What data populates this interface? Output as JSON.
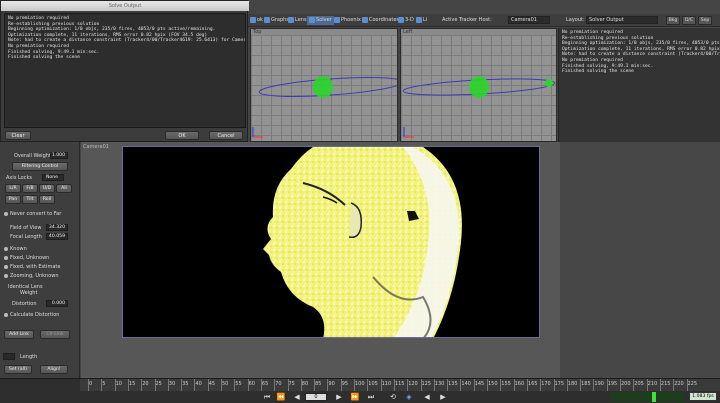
{
  "dialog": {
    "title": "Solve Output",
    "log": [
      "No premiation required",
      "Re-establishing previous solution",
      "Beginning optimization: 1/0 objs, 235/0 fires, 4053/0 pts active/remaining.",
      "Optimization complete, 11 iterations, RMS error 0.82 hpix (FOV 34.5 deg)",
      "Note: had to create a distance constraint (Tracker4/00/Tracker4619: 25.6413) for Camera01)",
      "No premiation required",
      "Finished solving, 9:49.1 min:sec.",
      "Finished solving the scene"
    ],
    "buttons": {
      "clear": "Clear",
      "ok": "OK",
      "cancel": "Cancel"
    }
  },
  "toolbar": {
    "items": [
      "ok",
      "Graphs",
      "Lens",
      "Solver",
      "Phoenix",
      "Coordinates",
      "3-D",
      "Li"
    ],
    "tracker_host_label": "Active Tracker Host:",
    "tracker_host_value": "Camera01",
    "layout_label": "Layout:",
    "layout_value": "Solver Output",
    "right_buttons": [
      "Bkg",
      "D/C",
      "Sep",
      "Crp"
    ]
  },
  "graphs": {
    "left_label": "Top",
    "right_label": "Left"
  },
  "right_log": [
    "No premiation required",
    "Re-establishing previous solution",
    "Beginning optimization: 1/0 objs, 235/0 fires, 4053/0 pts active/remai",
    "Optimization complete, 11 iterations, RMS error 0.82 hpix (FOV 34.5 d",
    "Note: had to create a distance constraint (Tracker4/00/Tracker4619: 25",
    "No premiation required",
    "Finished solving, 9:49.1 min:sec.",
    "Finished solving the scene"
  ],
  "left_panel": {
    "camera_label": "Camera01",
    "overall_weight_label": "Overall Weight",
    "overall_weight_value": "1.000",
    "filtering_button": "Filtering Control",
    "axis_locks_label": "Axis Locks",
    "axis_locks_value": "None",
    "axis_buttons_row1": [
      "L/R",
      "F/B",
      "U/D",
      "All"
    ],
    "axis_buttons_row2": [
      "Pan",
      "Tilt",
      "Roll"
    ],
    "never_convert": "Never convert to Far",
    "fov_label": "Field of View",
    "fov_value": "34.320",
    "focal_label": "Focal Length",
    "focal_value": "40.059",
    "radio_known": "Known",
    "radio_fixed_unknown": "Fixed, Unknown",
    "radio_fixed_estimate": "Fixed, with Estimate",
    "radio_zooming": "Zooming, Unknown",
    "identical_lens": "Identical Lens",
    "weight_label": "Weight",
    "distortion_label": "Distortion",
    "distortion_value": "0.000",
    "calc_distortion": "Calculate Distortion",
    "add_link": "Add Link",
    "clr_link": "Clr Link",
    "length_label": "Length",
    "set_btn": "Set (all)",
    "align_btn": "Align!"
  },
  "viewport": {
    "label": "Camera01"
  },
  "timeline": {
    "ticks": [
      "0",
      "5",
      "10",
      "15",
      "20",
      "25",
      "30",
      "35",
      "40",
      "45",
      "50",
      "55",
      "60",
      "65",
      "70",
      "75",
      "80",
      "85",
      "90",
      "95",
      "100",
      "105",
      "110",
      "115",
      "120",
      "125",
      "130",
      "135",
      "140",
      "145",
      "150",
      "155",
      "160",
      "165",
      "170",
      "175",
      "180",
      "185",
      "190",
      "195",
      "200",
      "205",
      "210",
      "215",
      "220",
      "225"
    ],
    "frame": "0",
    "fps": "1.083 fps"
  },
  "colors": {
    "accent": "#5a8fd6",
    "cloud": "#f0f060",
    "graph_bg": "#939393"
  }
}
